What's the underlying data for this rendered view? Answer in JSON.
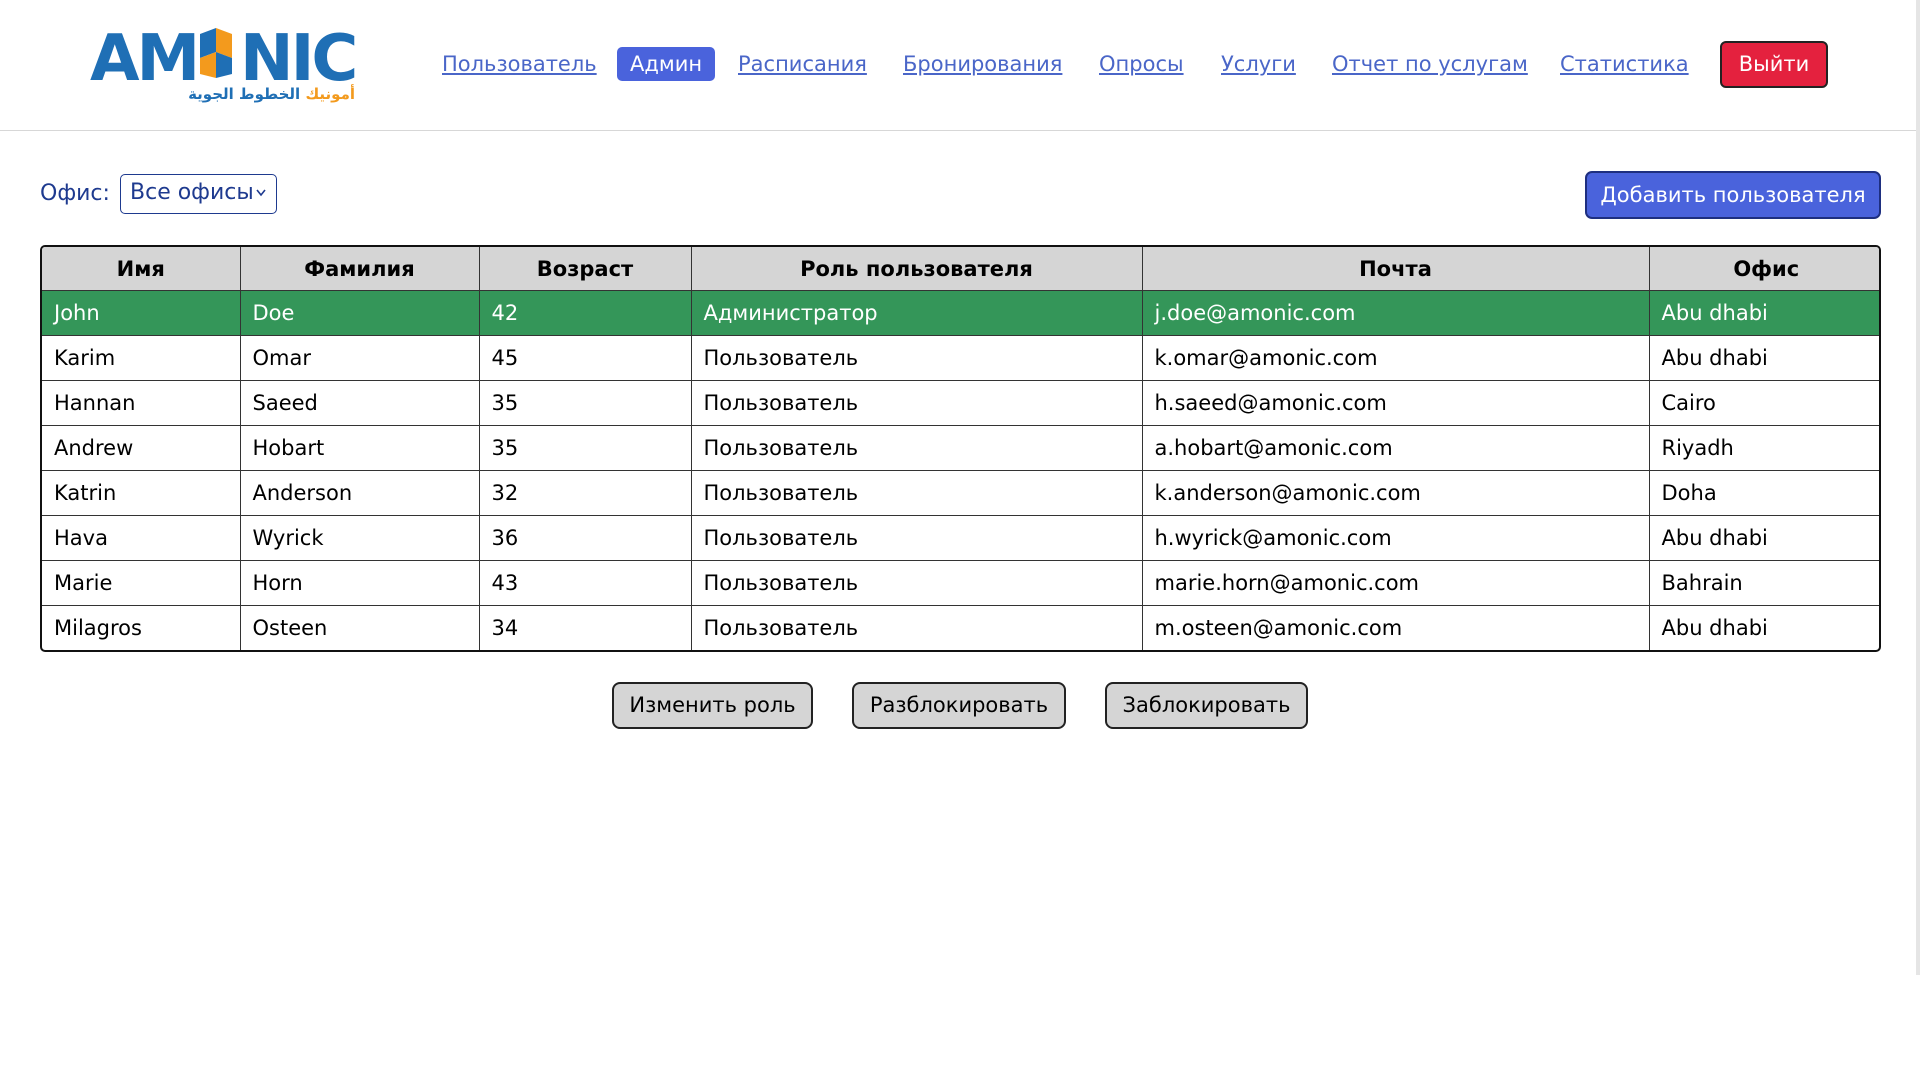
{
  "logo": {
    "text": "AMONIC",
    "arabic_orange": "أمونيك",
    "arabic_blue": "الخطوط الجوية"
  },
  "nav": {
    "items": [
      {
        "label": "Пользователь",
        "active": false
      },
      {
        "label": "Админ",
        "active": true
      },
      {
        "label": "Расписания",
        "active": false
      },
      {
        "label": "Бронирования",
        "active": false
      },
      {
        "label": "Опросы",
        "active": false
      },
      {
        "label": "Услуги",
        "active": false
      },
      {
        "label": "Отчет по услугам",
        "active": false
      },
      {
        "label": "Статистика",
        "active": false
      }
    ],
    "logout_label": "Выйти"
  },
  "toolbar": {
    "office_label": "Офис:",
    "office_selected": "Все офисы",
    "add_user_label": "Добавить пользователя"
  },
  "table": {
    "headers": [
      "Имя",
      "Фамилия",
      "Возраст",
      "Роль пользователя",
      "Почта",
      "Офис"
    ],
    "rows": [
      {
        "first": "John",
        "last": "Doe",
        "age": "42",
        "role": "Администратор",
        "email": "j.doe@amonic.com",
        "office": "Abu dhabi",
        "selected": true
      },
      {
        "first": "Karim",
        "last": "Omar",
        "age": "45",
        "role": "Пользователь",
        "email": "k.omar@amonic.com",
        "office": "Abu dhabi",
        "selected": false
      },
      {
        "first": "Hannan",
        "last": "Saeed",
        "age": "35",
        "role": "Пользователь",
        "email": "h.saeed@amonic.com",
        "office": "Cairo",
        "selected": false
      },
      {
        "first": "Andrew",
        "last": "Hobart",
        "age": "35",
        "role": "Пользователь",
        "email": "a.hobart@amonic.com",
        "office": "Riyadh",
        "selected": false
      },
      {
        "first": "Katrin",
        "last": "Anderson",
        "age": "32",
        "role": "Пользователь",
        "email": "k.anderson@amonic.com",
        "office": "Doha",
        "selected": false
      },
      {
        "first": "Hava",
        "last": "Wyrick",
        "age": "36",
        "role": "Пользователь",
        "email": "h.wyrick@amonic.com",
        "office": "Abu dhabi",
        "selected": false
      },
      {
        "first": "Marie",
        "last": "Horn",
        "age": "43",
        "role": "Пользователь",
        "email": "marie.horn@amonic.com",
        "office": "Bahrain",
        "selected": false
      },
      {
        "first": "Milagros",
        "last": "Osteen",
        "age": "34",
        "role": "Пользователь",
        "email": "m.osteen@amonic.com",
        "office": "Abu dhabi",
        "selected": false
      }
    ]
  },
  "actions": {
    "change_role": "Изменить роль",
    "unblock": "Разблокировать",
    "block": "Заблокировать"
  },
  "colors": {
    "accent": "#4a63dc",
    "logout": "#e4213e",
    "selected_row": "#349659",
    "header_bg": "#d5d5d5",
    "nav_link": "#4a66c8"
  }
}
